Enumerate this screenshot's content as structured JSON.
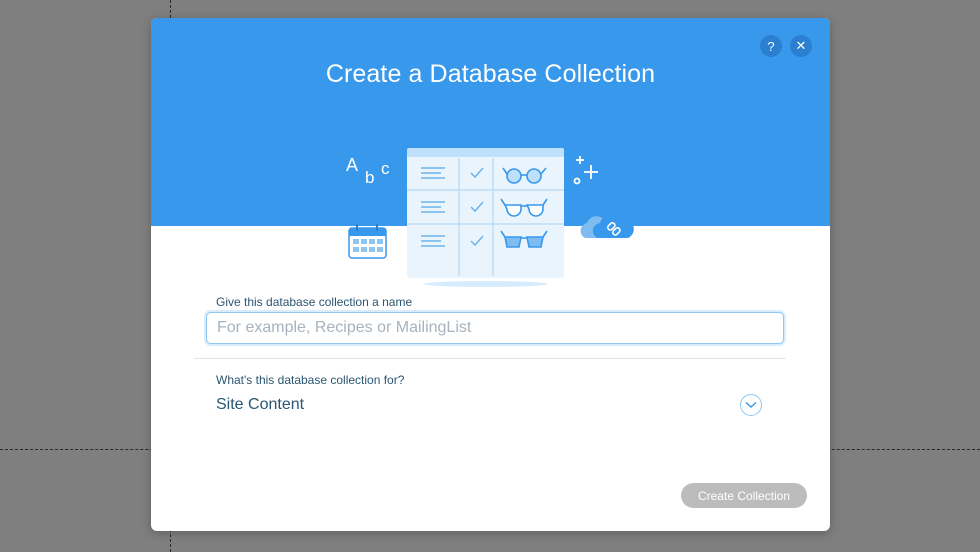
{
  "dialog": {
    "title": "Create a Database Collection",
    "help_label": "?",
    "close_label": "✕"
  },
  "illustration": {
    "letters": [
      "A",
      "b",
      "c"
    ],
    "rows": 3
  },
  "form": {
    "name_label": "Give this database collection a name",
    "name_placeholder": "For example, Recipes or MailingList",
    "name_value": "",
    "purpose_label": "What's this database collection for?",
    "purpose_value": "Site Content"
  },
  "footer": {
    "create_label": "Create Collection"
  },
  "colors": {
    "header_blue": "#3899ec",
    "text_dark_blue": "#2b5672",
    "disabled_button": "#bcbcbc"
  }
}
